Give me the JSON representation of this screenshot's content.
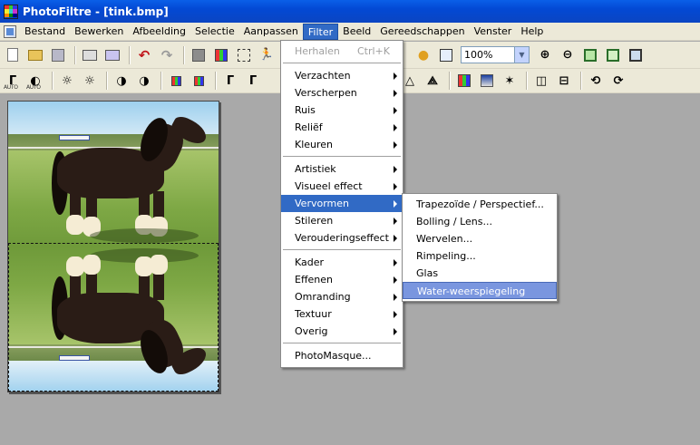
{
  "window": {
    "title": "PhotoFiltre - [tink.bmp]"
  },
  "menubar": {
    "items": [
      "Bestand",
      "Bewerken",
      "Afbeelding",
      "Selectie",
      "Aanpassen",
      "Filter",
      "Beeld",
      "Gereedschappen",
      "Venster",
      "Help"
    ],
    "active": "Filter"
  },
  "toolbar": {
    "zoom_value": "100%",
    "auto_label": "AUTO"
  },
  "document": {
    "filename": "tink.bmp"
  },
  "filter_menu": {
    "repeat_label": "Herhalen",
    "repeat_shortcut": "Ctrl+K",
    "group1": [
      "Verzachten",
      "Verscherpen",
      "Ruis",
      "Reliëf",
      "Kleuren"
    ],
    "group2": [
      "Artistiek",
      "Visueel effect",
      "Vervormen",
      "Stileren",
      "Verouderingseffect"
    ],
    "group3": [
      "Kader",
      "Effenen",
      "Omranding",
      "Textuur",
      "Overig"
    ],
    "photomasque": "PhotoMasque..."
  },
  "vervormen_submenu": {
    "items": [
      "Trapezoïde / Perspectief...",
      "Bolling / Lens...",
      "Wervelen...",
      "Rimpeling...",
      "Glas",
      "Water-weerspiegeling"
    ],
    "highlighted": "Water-weerspiegeling"
  },
  "colors": {
    "title_bar": "#0349d4",
    "menu_highlight": "#316ac5",
    "submenu_highlight": "#7a96df",
    "workspace": "#a9a9a9",
    "chrome": "#ece9d8"
  }
}
